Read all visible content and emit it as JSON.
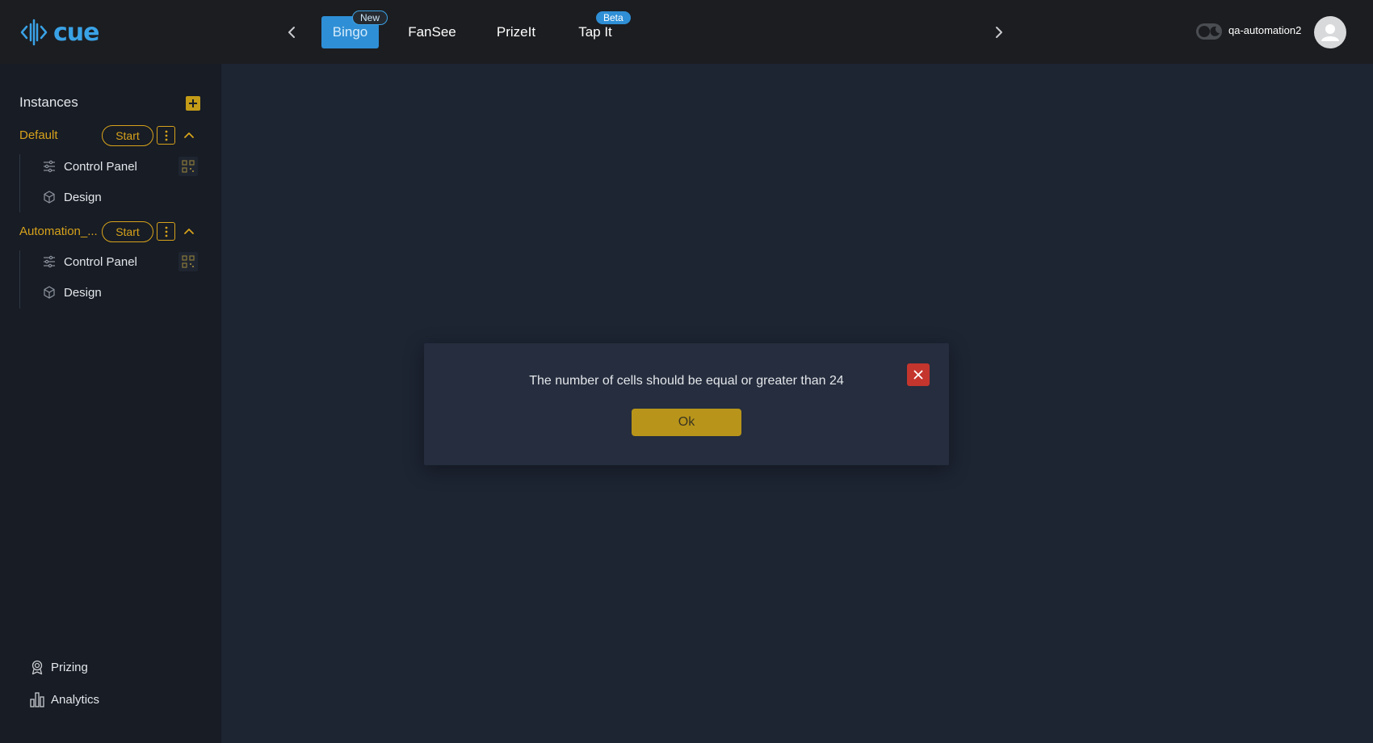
{
  "app": {
    "logo_text": "cue",
    "brand_color": "#3aa2e6",
    "accent_color": "#d7a21b"
  },
  "header": {
    "tabs": [
      {
        "label": "Bingo",
        "badge": "New",
        "active": true
      },
      {
        "label": "FanSee",
        "badge": "",
        "active": false
      },
      {
        "label": "PrizeIt",
        "badge": "",
        "active": false
      },
      {
        "label": "Tap It",
        "badge": "Beta",
        "active": false
      }
    ],
    "username": "qa-automation2",
    "icons": [
      "chevron-left-icon",
      "chevron-right-icon",
      "moon-icon",
      "user-icon"
    ]
  },
  "sidebar": {
    "title": "Instances",
    "instances": [
      {
        "name": "Default",
        "start_label": "Start",
        "items": [
          {
            "label": "Control Panel",
            "icon": "sliders-icon"
          },
          {
            "label": "Design",
            "icon": "cube-icon"
          }
        ]
      },
      {
        "name": "Automation_...",
        "start_label": "Start",
        "items": [
          {
            "label": "Control Panel",
            "icon": "sliders-icon"
          },
          {
            "label": "Design",
            "icon": "cube-icon"
          }
        ]
      }
    ],
    "bottom": [
      {
        "label": "Prizing",
        "icon": "award-icon"
      },
      {
        "label": "Analytics",
        "icon": "bar-chart-icon"
      }
    ]
  },
  "modal": {
    "message": "The number of cells should be equal or greater than 24",
    "ok_label": "Ok"
  }
}
